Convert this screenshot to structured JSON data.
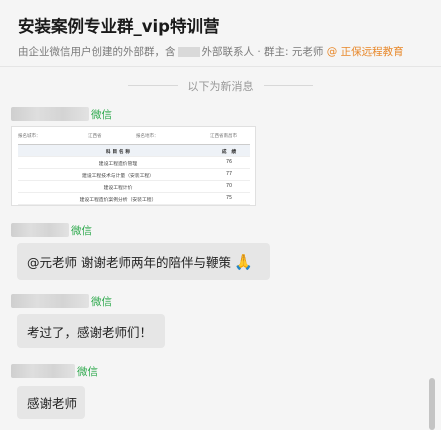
{
  "chat": {
    "title": "安装案例专业群_vip特训营",
    "subtitle_prefix": "由企业微信用户创建的外部群，含",
    "subtitle_middle": "外部联系人 · 群主: 元老师",
    "subtitle_org": "@ 正保远程教育"
  },
  "divider": {
    "text": "以下为新消息"
  },
  "doc_preview": {
    "head": [
      "报名城市：",
      "江西省",
      "报名地市：",
      "江西省南昌市"
    ],
    "columns": [
      "科 目 名 称",
      "成　绩"
    ],
    "rows": [
      {
        "subject": "建设工程造价管理",
        "score": "76"
      },
      {
        "subject": "建设工程技术与计量（安装工程）",
        "score": "77"
      },
      {
        "subject": "建设工程计价",
        "score": "70"
      },
      {
        "subject": "建设工程造价案例分析（安装工程）",
        "score": "75"
      }
    ]
  },
  "messages": [
    {
      "source": "微信",
      "text": ""
    },
    {
      "source": "微信",
      "text": "@元老师 谢谢老师两年的陪伴与鞭策",
      "emoji": "🙏"
    },
    {
      "source": "微信",
      "text": "考过了，感谢老师们！"
    },
    {
      "source": "微信",
      "text": "感谢老师"
    }
  ]
}
